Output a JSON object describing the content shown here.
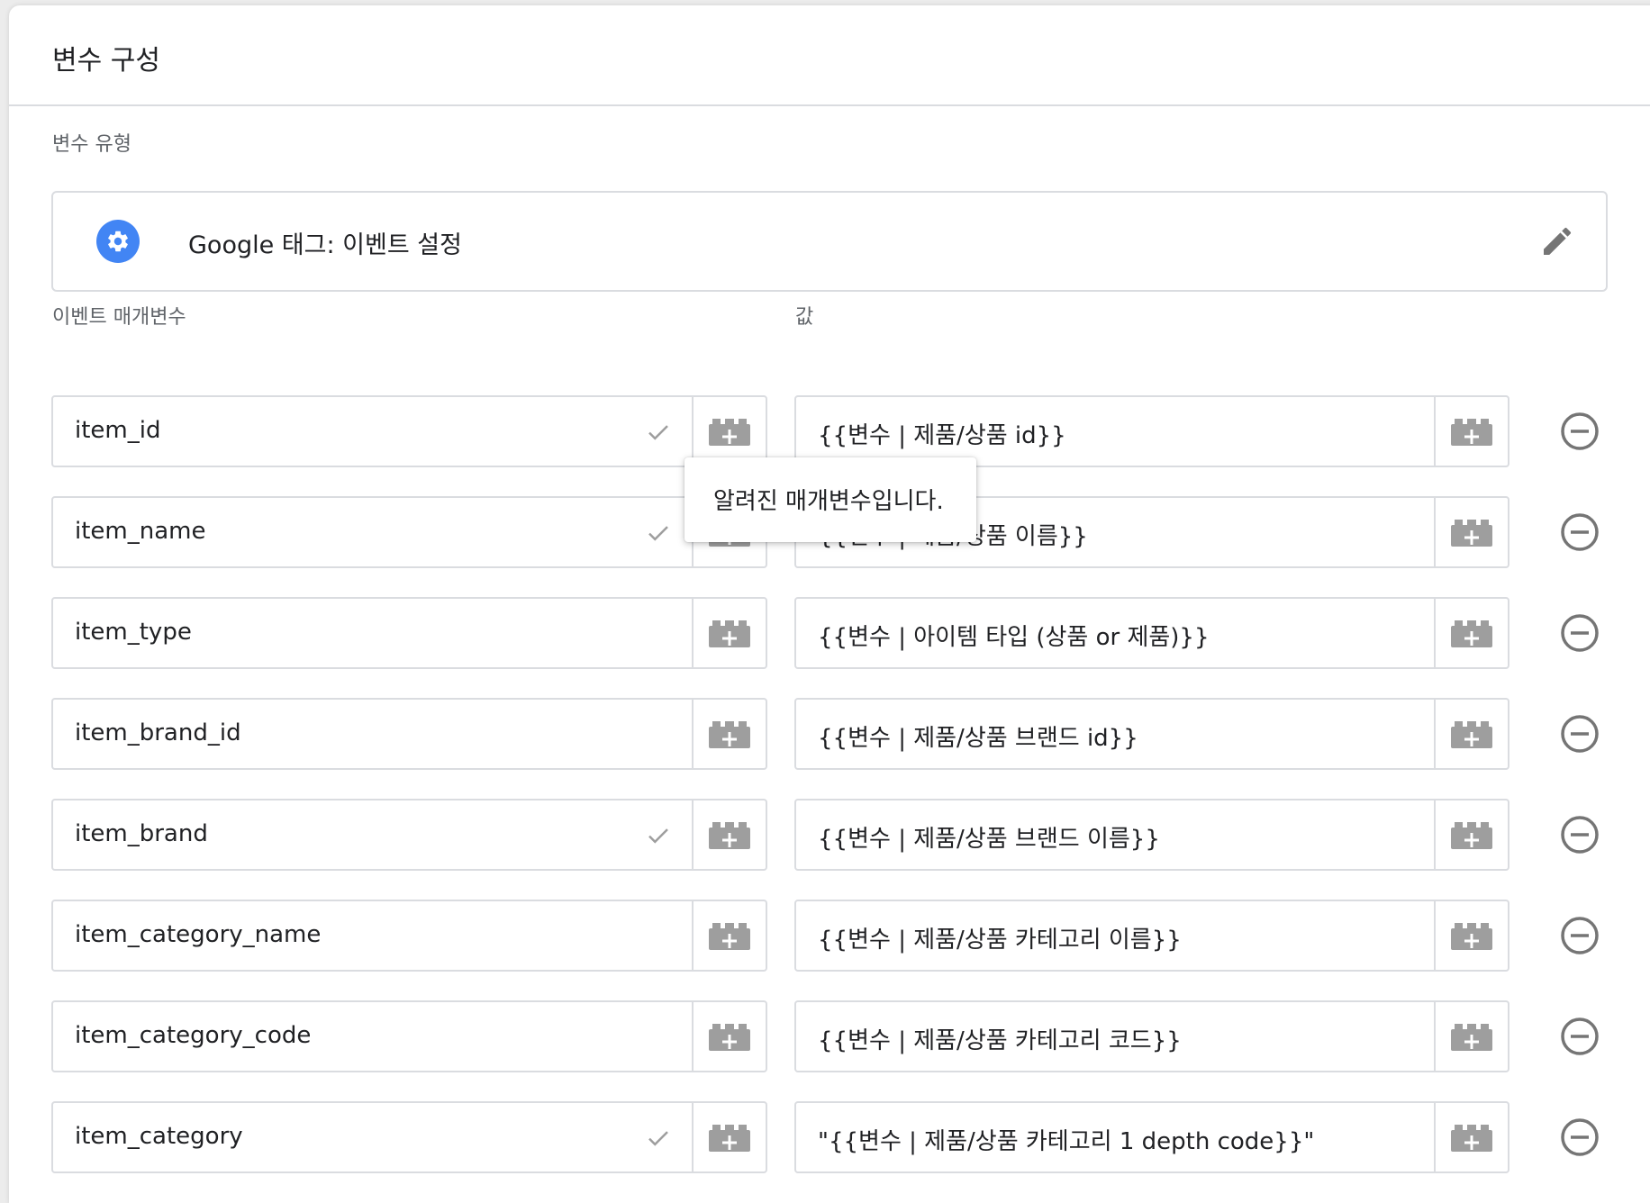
{
  "header": {
    "title": "변수 구성"
  },
  "variable_type": {
    "label": "변수 유형",
    "name": "Google 태그: 이벤트 설정",
    "icon": "gear-icon",
    "edit_icon": "pencil-icon",
    "accent_color": "#4285f4"
  },
  "columns": {
    "parameter_label": "이벤트 매개변수",
    "value_label": "값"
  },
  "tooltip": {
    "text": "알려진 매개변수입니다."
  },
  "rows": [
    {
      "name": "item_id",
      "value": "{{변수 | 제품/상품 id}}",
      "known": true
    },
    {
      "name": "item_name",
      "value": "{{변수 | 제품/상품 이름}}",
      "known": true
    },
    {
      "name": "item_type",
      "value": "{{변수 | 아이템 타입 (상품 or 제품)}}",
      "known": false
    },
    {
      "name": "item_brand_id",
      "value": "{{변수 | 제품/상품 브랜드 id}}",
      "known": false
    },
    {
      "name": "item_brand",
      "value": "{{변수 | 제품/상품 브랜드 이름}}",
      "known": true
    },
    {
      "name": "item_category_name",
      "value": "{{변수 | 제품/상품 카테고리 이름}}",
      "known": false
    },
    {
      "name": "item_category_code",
      "value": "{{변수 | 제품/상품 카테고리 코드}}",
      "known": false
    },
    {
      "name": "item_category",
      "value": "\"{{변수 | 제품/상품 카테고리 1 depth code}}\"",
      "known": true
    }
  ]
}
